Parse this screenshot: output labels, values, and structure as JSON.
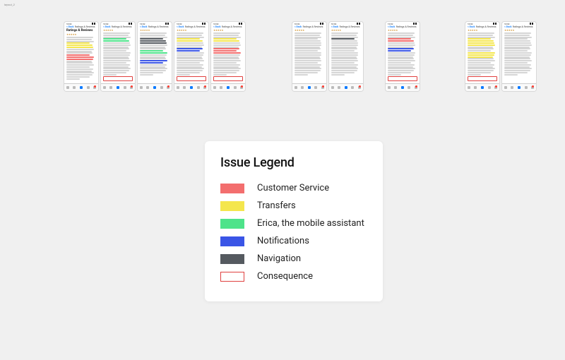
{
  "tiny_label": "layout_2",
  "phone_header": {
    "time": "10:02",
    "back": "< Back",
    "title_center": "Ratings & Reviews",
    "page_title": "Ratings & Reviews"
  },
  "colors": {
    "customer_service": "#f36e6e",
    "transfers": "#f4e64d",
    "erica": "#4ee38a",
    "notifications": "#3a55e6",
    "navigation": "#555a60",
    "consequence_border": "#e0403f"
  },
  "legend": {
    "title": "Issue Legend",
    "items": [
      {
        "swatch": "sw-red",
        "label": "Customer Service"
      },
      {
        "swatch": "sw-yellow",
        "label": "Transfers"
      },
      {
        "swatch": "sw-green",
        "label": "Erica, the mobile assistant"
      },
      {
        "swatch": "sw-blue",
        "label": "Notifications"
      },
      {
        "swatch": "sw-grey",
        "label": "Navigation"
      },
      {
        "swatch": "sw-outline",
        "label": "Consequence"
      }
    ]
  },
  "clusters": [
    {
      "phones": [
        {
          "show_big_title": true,
          "highlights": [
            [
              "yellow",
              3
            ],
            [
              "red",
              3
            ]
          ],
          "outline": false
        },
        {
          "show_big_title": false,
          "highlights": [
            [
              "green",
              2
            ]
          ],
          "outline": true
        },
        {
          "show_big_title": false,
          "highlights": [
            [
              "grey",
              3
            ],
            [
              "green",
              2
            ],
            [
              "blue",
              2
            ]
          ],
          "outline": false
        },
        {
          "show_big_title": false,
          "highlights": [
            [
              "yellow",
              2
            ],
            [
              "blue",
              2
            ]
          ],
          "outline": true
        },
        {
          "show_big_title": false,
          "highlights": [
            [
              "yellow",
              2
            ],
            [
              "red",
              3
            ]
          ],
          "outline": true
        }
      ]
    },
    {
      "phones": [
        {
          "show_big_title": false,
          "highlights": [],
          "outline": false
        },
        {
          "show_big_title": false,
          "highlights": [
            [
              "grey",
              1
            ]
          ],
          "outline": false
        }
      ]
    },
    {
      "phones": [
        {
          "show_big_title": false,
          "highlights": [
            [
              "red",
              2
            ],
            [
              "blue",
              2
            ]
          ],
          "outline": true
        }
      ]
    },
    {
      "phones": [
        {
          "show_big_title": false,
          "highlights": [
            [
              "yellow",
              4
            ],
            [
              "yellow",
              3
            ]
          ],
          "outline": true
        },
        {
          "show_big_title": false,
          "highlights": [],
          "outline": false
        }
      ]
    }
  ]
}
